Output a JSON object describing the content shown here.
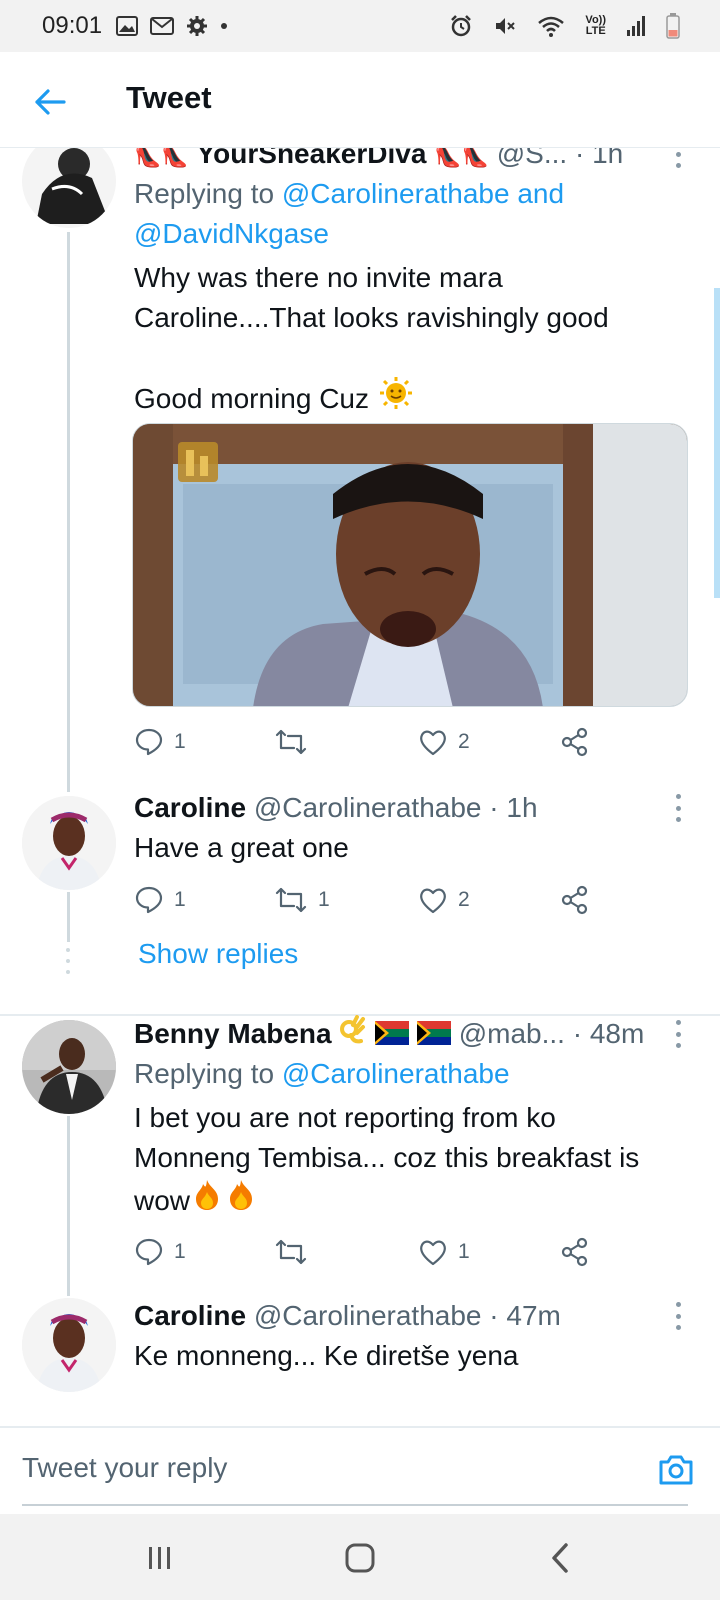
{
  "status_bar": {
    "time": "09:01",
    "icons_left": [
      "gallery-icon",
      "gmail-icon",
      "settings-icon",
      "dot-icon"
    ],
    "icons_right": [
      "alarm-icon",
      "mute-icon",
      "wifi-icon",
      "volte-icon",
      "signal-icon",
      "battery-icon"
    ],
    "volte_top": "Vo))",
    "volte_bottom": "LTE"
  },
  "header": {
    "title": "Tweet",
    "back_icon": "arrow-left-icon"
  },
  "colors": {
    "accent": "#1d9bf0",
    "text": "#0f1419",
    "secondary": "#536471",
    "divider": "#e6ecf0"
  },
  "tweets": [
    {
      "name": "YourSneakerDiva",
      "name_decoration": "👠👠",
      "handle": "@S...",
      "time": "· 1h",
      "replying_prefix": "Replying to",
      "replying_to": "@Carolinerathabe and",
      "replying_to_2": "@DavidNkgase",
      "text_line1": "Why was there no invite mara",
      "text_line2": "Caroline....That looks ravishingly good",
      "text_line3": "Good morning Cuz",
      "emoji": "sun-face",
      "has_media": true,
      "replies": "1",
      "retweets": "",
      "likes": "2"
    },
    {
      "name": "Caroline",
      "handle": "@Carolinerathabe",
      "time": "· 1h",
      "text_line1": "Have a great one",
      "replies": "1",
      "retweets": "1",
      "likes": "2",
      "show_replies": "Show replies"
    },
    {
      "name": "Benny Mabena",
      "name_emojis": [
        "ok-hand",
        "south-africa-flag",
        "south-africa-flag"
      ],
      "handle": "@mab...",
      "time": "· 48m",
      "replying_prefix": "Replying to",
      "replying_to": "@Carolinerathabe",
      "text_line1": "I bet you are not  reporting from ko",
      "text_line2": "Monneng Tembisa... coz this breakfast is",
      "text_line3": "wow",
      "trailing_emojis": [
        "fire",
        "fire"
      ],
      "replies": "1",
      "retweets": "",
      "likes": "1"
    },
    {
      "name": "Caroline",
      "handle": "@Carolinerathabe",
      "time": "· 47m",
      "text_line1": "Ke monneng... Ke diretše yena"
    }
  ],
  "reply_bar": {
    "placeholder": "Tweet your reply",
    "camera_icon": "camera-icon"
  },
  "nav_bar": {
    "buttons": [
      "recents-icon",
      "home-icon",
      "back-icon"
    ]
  }
}
